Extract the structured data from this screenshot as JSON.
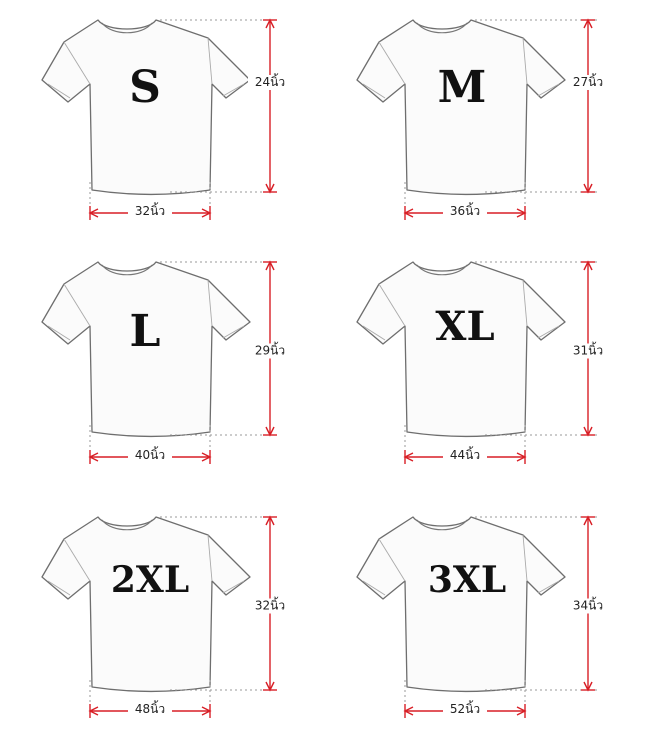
{
  "chart_data": {
    "type": "table",
    "unit_label": "นิ้ว",
    "sizes": [
      {
        "size": "S",
        "length": "24นิ้ว",
        "chest": "32นิ้ว"
      },
      {
        "size": "M",
        "length": "27นิ้ว",
        "chest": "36นิ้ว"
      },
      {
        "size": "L",
        "length": "29นิ้ว",
        "chest": "40นิ้ว"
      },
      {
        "size": "XL",
        "length": "31นิ้ว",
        "chest": "44นิ้ว"
      },
      {
        "size": "2XL",
        "length": "32นิ้ว",
        "chest": "48นิ้ว"
      },
      {
        "size": "3XL",
        "length": "34นิ้ว",
        "chest": "52นิ้ว"
      }
    ]
  },
  "colors": {
    "measure_line": "#d81f26",
    "shirt_outline": "#6e6e6e",
    "shirt_fill": "#fbfbfb",
    "label_text": "#111111"
  },
  "icons": [
    "tshirt-icon"
  ]
}
